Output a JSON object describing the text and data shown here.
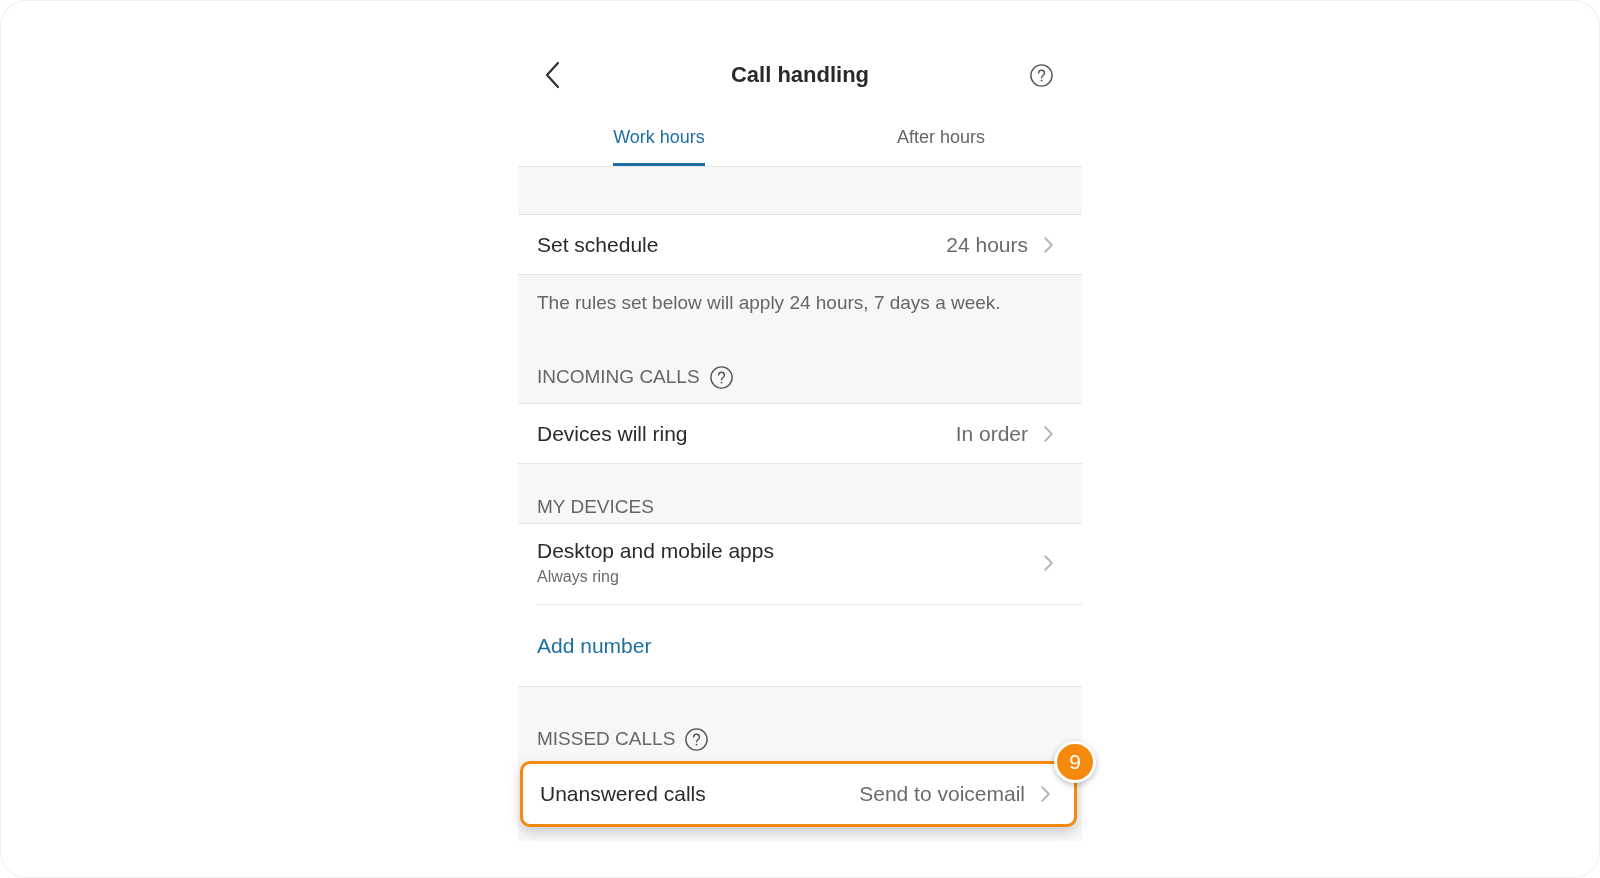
{
  "header": {
    "title": "Call handling"
  },
  "tabs": [
    {
      "label": "Work hours",
      "selected": true
    },
    {
      "label": "After hours",
      "selected": false
    }
  ],
  "schedule": {
    "label": "Set schedule",
    "value": "24 hours"
  },
  "schedule_note": "The rules set below will apply 24 hours, 7 days a week.",
  "sections": [
    {
      "heading": "INCOMING CALLS",
      "help": true,
      "rows": [
        {
          "kind": "setting",
          "label": "Devices will ring",
          "value": "In order",
          "highlighted": false
        }
      ]
    },
    {
      "heading": "MY DEVICES",
      "help": false,
      "rows": [
        {
          "kind": "device",
          "label": "Desktop and mobile apps",
          "sublabel": "Always ring",
          "highlighted": false
        },
        {
          "kind": "link",
          "label": "Add number",
          "highlighted": false
        }
      ]
    },
    {
      "heading": "MISSED CALLS",
      "help": true,
      "rows": [
        {
          "kind": "setting",
          "label": "Unanswered calls",
          "value": "Send to voicemail",
          "highlighted": true,
          "callout": "9"
        }
      ]
    }
  ]
}
